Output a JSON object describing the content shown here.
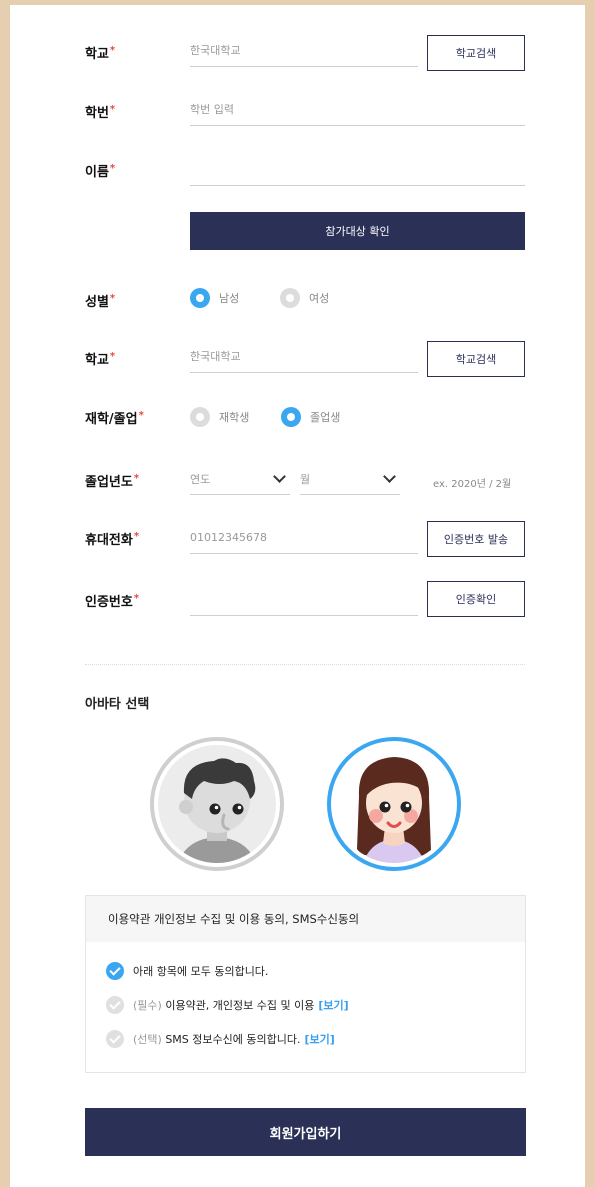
{
  "form": {
    "school1": {
      "label": "학교",
      "placeholder": "한국대학교",
      "button": "학교검색"
    },
    "student_id": {
      "label": "학번",
      "placeholder": "학번 입력"
    },
    "name": {
      "label": "이름",
      "value": ""
    },
    "verify_button": "참가대상 확인",
    "gender": {
      "label": "성별",
      "male": "남성",
      "female": "여성",
      "selected": "남성"
    },
    "school2": {
      "label": "학교",
      "placeholder": "한국대학교",
      "button": "학교검색"
    },
    "status": {
      "label": "재학/졸업",
      "enrolled": "재학생",
      "graduated": "졸업생",
      "selected": "졸업생"
    },
    "grad_year": {
      "label": "졸업년도",
      "year_placeholder": "연도",
      "month_placeholder": "월",
      "hint": "ex. 2020년 / 2월"
    },
    "phone": {
      "label": "휴대전화",
      "value": "01012345678",
      "button": "인증번호 발송"
    },
    "auth_code": {
      "label": "인증번호",
      "value": "",
      "button": "인증확인"
    },
    "required_mark": "*"
  },
  "avatar": {
    "title": "아바타 선택",
    "options": [
      "boy",
      "girl"
    ],
    "selected": "girl"
  },
  "terms": {
    "title": "이용약관 개인정보 수집 및 이용 동의, SMS수신동의",
    "all": "아래 항목에 모두 동의합니다.",
    "required_prefix": "(필수)",
    "required_text": "이용약관, 개인정보 수집 및 이용",
    "optional_prefix": "(선택)",
    "optional_text": "SMS 정보수신에 동의합니다.",
    "view_link": "[보기]"
  },
  "submit_button": "회원가입하기",
  "colors": {
    "navy": "#2b3057",
    "accent": "#3aa7f0",
    "required": "#e84a3c",
    "background": "#e5cfb0"
  }
}
